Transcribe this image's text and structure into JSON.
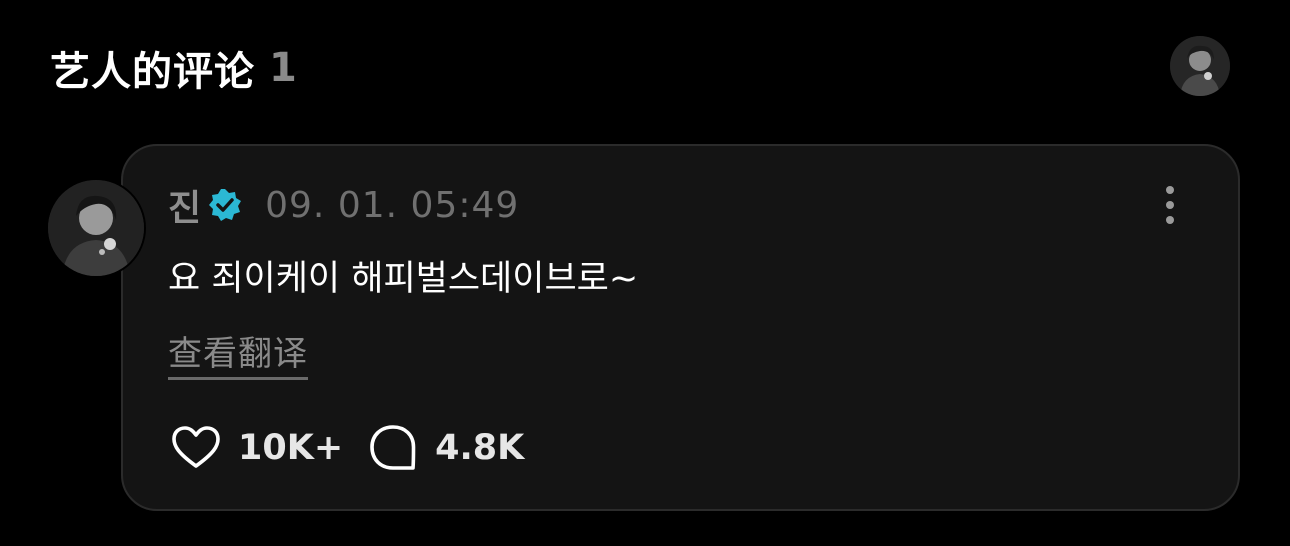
{
  "header": {
    "title": "艺人的评论",
    "count": "1",
    "avatar_icon": "artist-avatar-icon"
  },
  "comment": {
    "author": "진",
    "verified_icon": "verified-badge-icon",
    "verified_color": "#2bb8d4",
    "timestamp": "09. 01. 05:49",
    "text": "요 죄이케이 해피벌스데이브로~",
    "translate_label": "查看翻译",
    "more_icon": "more-vertical-icon",
    "likes": "10K+",
    "like_icon": "heart-icon",
    "replies": "4.8K",
    "reply_icon": "comment-bubble-icon"
  },
  "colors": {
    "background": "#000000",
    "card": "#141414",
    "card_border": "#2b2b2b",
    "muted_text": "#8a8a8a"
  }
}
